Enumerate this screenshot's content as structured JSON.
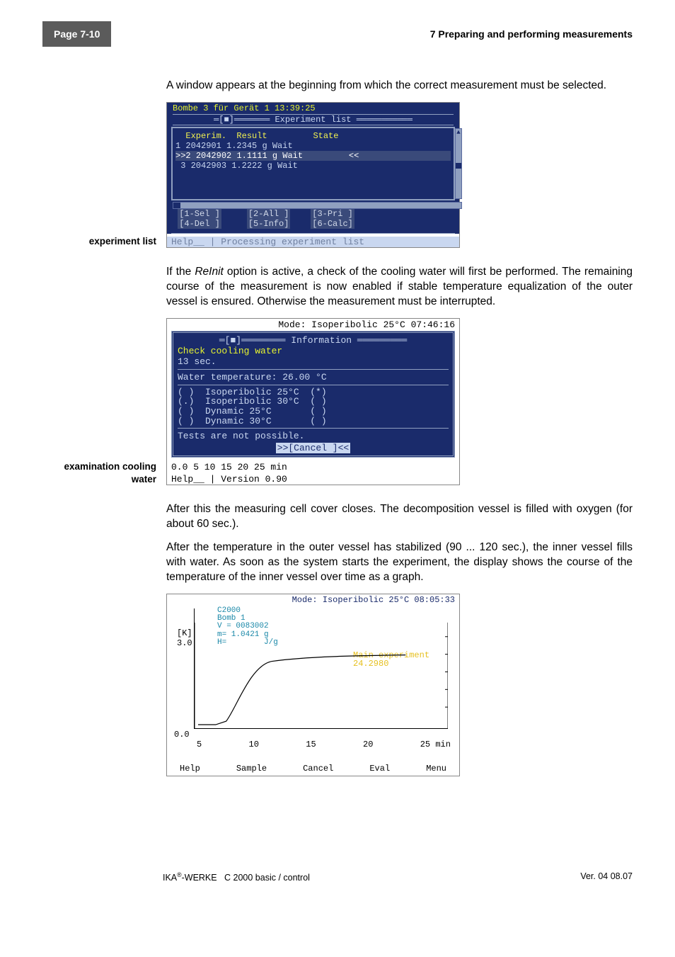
{
  "header": {
    "page_tab": "Page 7-10",
    "chapter_title": "7 Preparing and performing measurements"
  },
  "para1": "A window appears at the beginning from which the correct measurement must be selected.",
  "fig1_label": "experiment list",
  "fig1": {
    "title_line": "Bombe 3 für Gerät 1    13:39:25",
    "window_title": " Experiment list ",
    "head_experim": "Experim.",
    "head_result": "Result",
    "head_state": "State",
    "rows": [
      {
        "n": "1",
        "id": "2042901",
        "res": "1.2345 g",
        "st": "Wait"
      },
      {
        "n": "2",
        "id": "2042902",
        "res": "1.1111 g",
        "st": "Wait"
      },
      {
        "n": "3",
        "id": "2042903",
        "res": "1.2222 g",
        "st": "Wait"
      }
    ],
    "btn1": "[1-Sel ]",
    "btn2": "[2-All ]",
    "btn3": "[3-Pri ]",
    "btn4": "[4-Del ]",
    "btn5": "[5-Info]",
    "btn6": "[6-Calc]",
    "status": "Help__ | Processing experiment list"
  },
  "para2a": "If the ",
  "para2_i": "ReInit",
  "para2b": " option is active, a check of the cooling water will first be performed. The remaining course of the measurement is now enabled if stable temperature equalization of the outer vessel is ensured. Otherwise the measurement must be interrupted.",
  "fig2_label": "examination cooling water",
  "fig2": {
    "top": "Mode: Isoperibolic 25°C 07:46:16",
    "win_title": " Information ",
    "check_line": "Check cooling water",
    "sec_line": " 13 sec.",
    "water_line": "Water temperature:  26.00 °C",
    "modes": "( )  Isoperibolic 25°C  (*)\n(.)  Isoperibolic 30°C  ( )\n( )  Dynamic 25°C       ( )\n( )  Dynamic 30°C       ( )",
    "tests_line": "Tests are not possible.",
    "cancel": ">>[Cancel ]<<",
    "axis": "0.0     5     10    15    20    25 min",
    "help": "Help__ | Version 0.90"
  },
  "para3": "After this the measuring cell cover closes. The decomposition vessel is filled with oxygen (for about 60 sec.).",
  "para4": "After the temperature in the outer vessel has stabilized (90 ... 120 sec.), the inner vessel fills with water. As soon as the system starts the experiment, the display shows the course of the temperature of the inner vessel over time as a graph.",
  "fig3": {
    "top": "Mode: Isoperibolic 25°C 08:05:33",
    "info": "C2000\nBomb 1\nV = 0083002\nm= 1.0421 g\nH=        J/g",
    "yk": "[K]\n3.0",
    "main_label": "Main experiment\n24.2980",
    "y0": "0.0",
    "xticks": [
      "5",
      "10",
      "15",
      "20",
      "25 min"
    ],
    "menu": [
      "Help",
      "Sample",
      "Cancel",
      "Eval",
      "Menu"
    ]
  },
  "footer": {
    "left": "IKA®-WERKE   C 2000 basic / control",
    "right": "Ver. 04  08.07"
  }
}
